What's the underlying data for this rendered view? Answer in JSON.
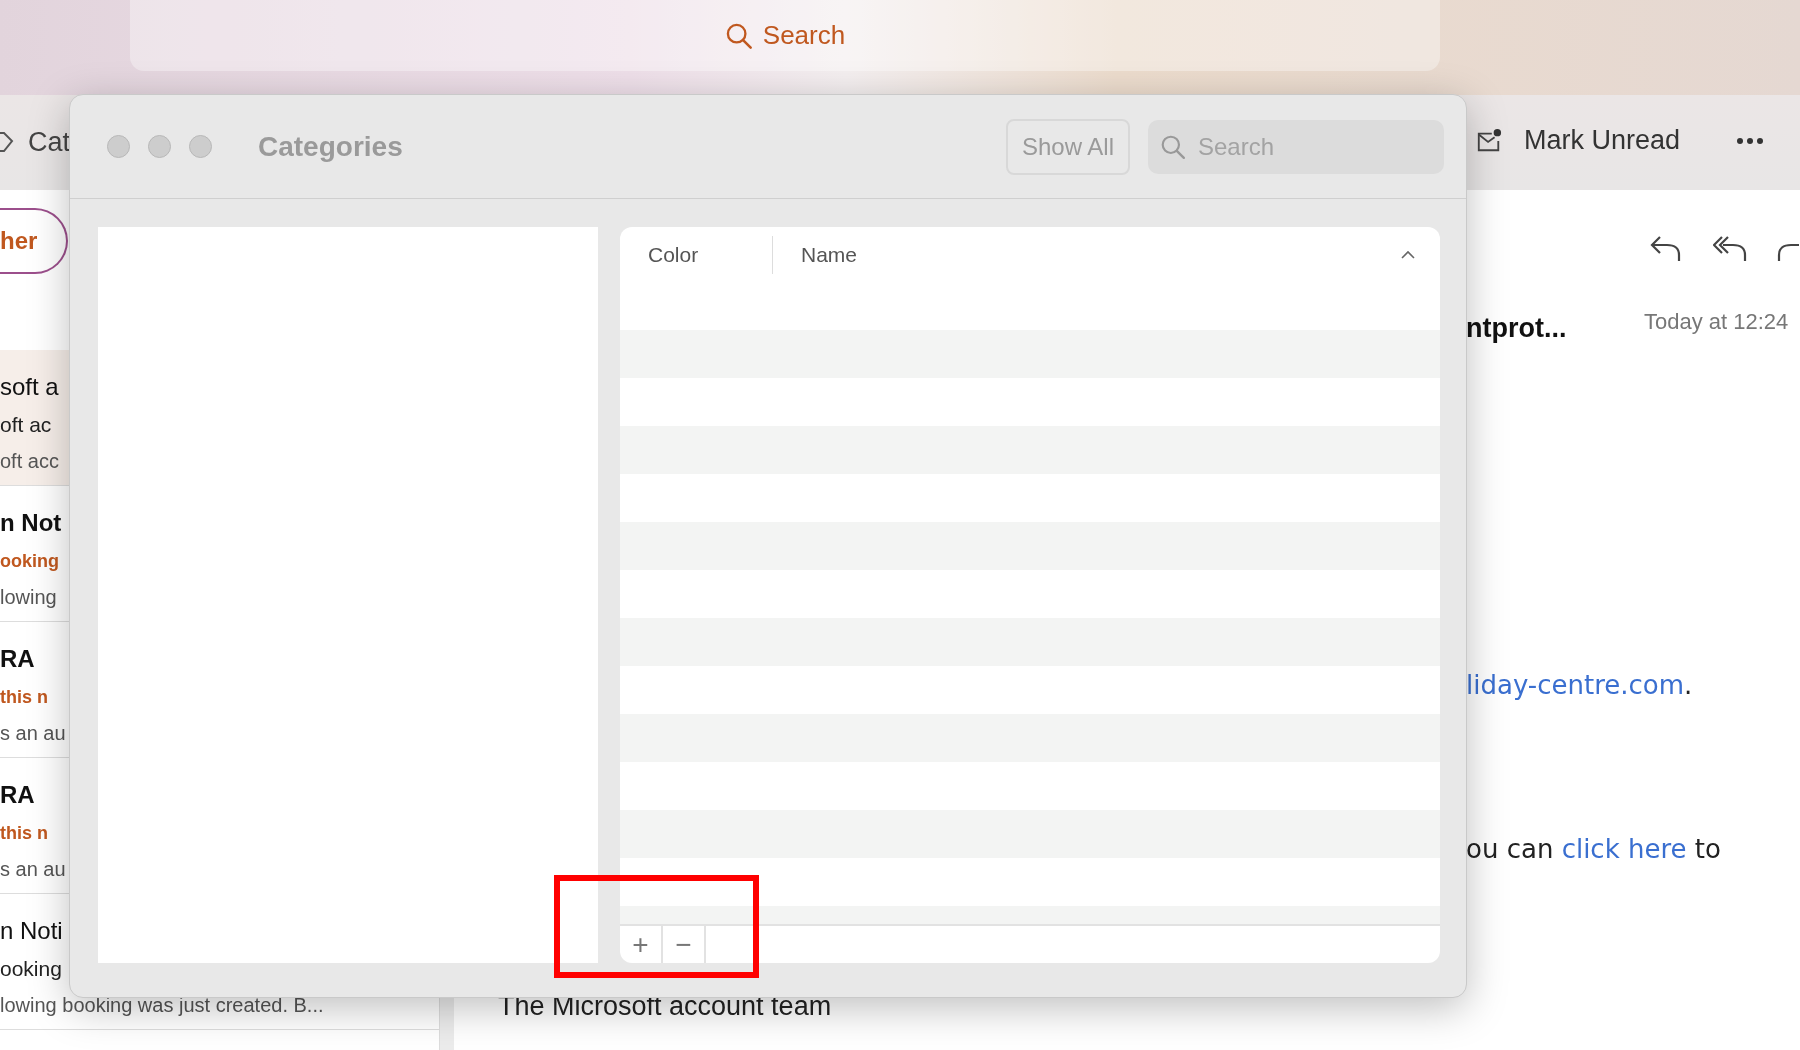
{
  "top_search": {
    "label": "Search"
  },
  "toolbar": {
    "categorize_label": "Cat",
    "mark_unread_label": "Mark Unread"
  },
  "filter_pill": {
    "label": "her"
  },
  "messages": [
    {
      "sender": "soft a",
      "subject": "oft ac",
      "preview": "oft acc",
      "selected": true,
      "unread": false
    },
    {
      "sender": "n Not",
      "subject": "ooking",
      "preview": "lowing",
      "selected": false,
      "unread": true
    },
    {
      "sender": "RA",
      "subject": "this n",
      "preview": "s an au",
      "selected": false,
      "unread": true
    },
    {
      "sender": "RA",
      "subject": "this n",
      "preview": "s an au",
      "selected": false,
      "unread": true
    },
    {
      "sender": "n Noti",
      "subject": "ooking",
      "preview": "lowing booking was just created. B...",
      "selected": false,
      "unread": false
    }
  ],
  "reading_pane": {
    "subject": "ntprot...",
    "time": "Today at 12:24",
    "link_line": {
      "link": "liday-centre.com",
      "after": "."
    },
    "click_line": {
      "before": "ou can ",
      "link": "click here",
      "after": " to"
    },
    "signature": "The Microsoft account team"
  },
  "dialog": {
    "title": "Categories",
    "show_all_label": "Show All",
    "search": {
      "placeholder": "Search"
    },
    "columns": [
      {
        "label": "Color",
        "sorted": false
      },
      {
        "label": "Name",
        "sorted": true
      }
    ],
    "footer_buttons": [
      "+",
      "−"
    ]
  }
}
